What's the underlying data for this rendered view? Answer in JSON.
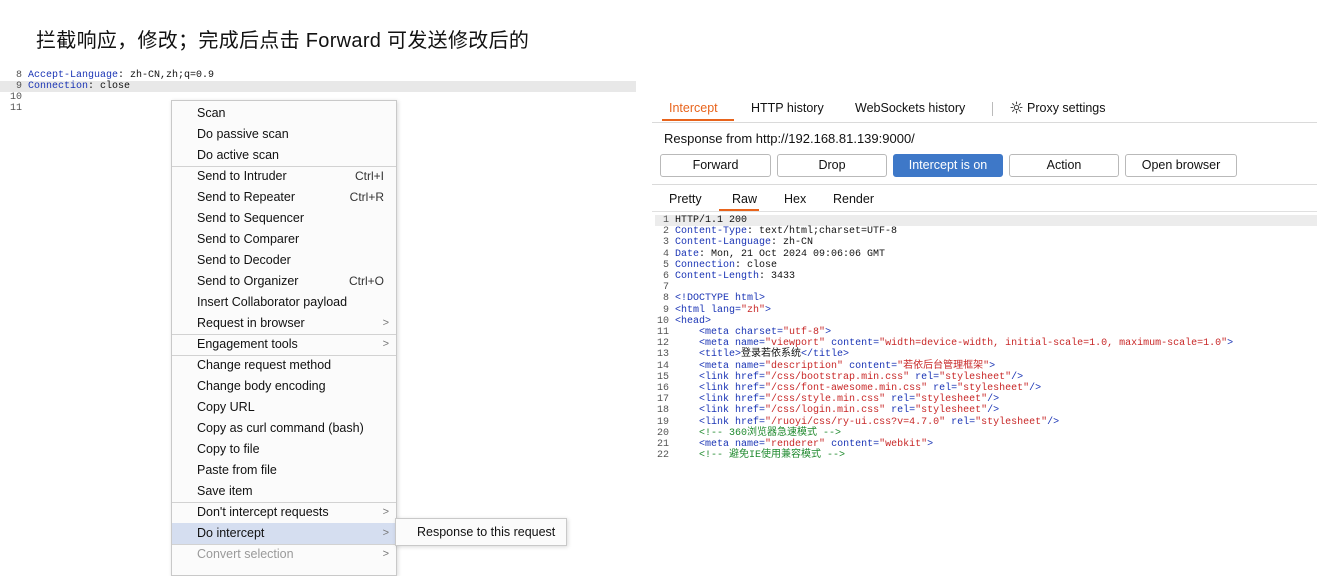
{
  "caption": "拦截响应，修改；完成后点击 Forward 可发送修改后的",
  "left_editor": {
    "lines": [
      {
        "num": "8",
        "key": "Accept-Language",
        "value": ": zh-CN,zh;q=0.9"
      },
      {
        "num": "9",
        "key": "Connection",
        "value": ": close"
      },
      {
        "num": "10",
        "key": "",
        "value": ""
      },
      {
        "num": "11",
        "key": "",
        "value": ""
      }
    ]
  },
  "context_menu": {
    "items": [
      {
        "label": "Scan"
      },
      {
        "label": "Do passive scan"
      },
      {
        "label": "Do active scan"
      },
      {
        "label": "Send to Intruder",
        "shortcut": "Ctrl+I"
      },
      {
        "label": "Send to Repeater",
        "shortcut": "Ctrl+R"
      },
      {
        "label": "Send to Sequencer"
      },
      {
        "label": "Send to Comparer"
      },
      {
        "label": "Send to Decoder"
      },
      {
        "label": "Send to Organizer",
        "shortcut": "Ctrl+O"
      },
      {
        "label": "Insert Collaborator payload"
      },
      {
        "label": "Request in browser",
        "arrow": ">"
      },
      {
        "label": "Engagement tools",
        "arrow": ">"
      },
      {
        "label": "Change request method"
      },
      {
        "label": "Change body encoding"
      },
      {
        "label": "Copy URL"
      },
      {
        "label": "Copy as curl command (bash)"
      },
      {
        "label": "Copy to file"
      },
      {
        "label": "Paste from file"
      },
      {
        "label": "Save item"
      },
      {
        "label": "Don't intercept requests",
        "arrow": ">"
      },
      {
        "label": "Do intercept",
        "arrow": ">"
      },
      {
        "label": "Convert selection",
        "arrow": ">"
      }
    ],
    "submenu_label": "Response to this request"
  },
  "tabs": {
    "intercept": "Intercept",
    "http_history": "HTTP history",
    "websockets_history": "WebSockets history",
    "proxy_settings": "Proxy settings"
  },
  "response_from": "Response from http://192.168.81.139:9000/",
  "buttons": {
    "forward": "Forward",
    "drop": "Drop",
    "intercept_on": "Intercept is on",
    "action": "Action",
    "open_browser": "Open browser"
  },
  "subtabs": {
    "pretty": "Pretty",
    "raw": "Raw",
    "hex": "Hex",
    "render": "Render"
  },
  "colors": {
    "accent": "#e8641c",
    "primary_button": "#3e78c8",
    "menu_highlight": "#d5def0"
  },
  "response_lines": [
    {
      "num": "1",
      "text": "HTTP/1.1 200"
    },
    {
      "num": "2",
      "header": "Content-Type",
      "value": ": text/html;charset=UTF-8"
    },
    {
      "num": "3",
      "header": "Content-Language",
      "value": ": zh-CN"
    },
    {
      "num": "4",
      "header": "Date",
      "value": ": Mon, 21 Oct 2024 09:06:06 GMT"
    },
    {
      "num": "5",
      "header": "Connection",
      "value": ": close"
    },
    {
      "num": "6",
      "header": "Content-Length",
      "value": ": 3433"
    },
    {
      "num": "7",
      "text": ""
    },
    {
      "num": "8",
      "html": [
        [
          "tg",
          "<!DOCTYPE html>"
        ]
      ]
    },
    {
      "num": "9",
      "html": [
        [
          "tg",
          "<html "
        ],
        [
          "at",
          "lang="
        ],
        [
          "av",
          "\"zh\""
        ],
        [
          "tg",
          ">"
        ]
      ]
    },
    {
      "num": "10",
      "html": [
        [
          "tg",
          "<head>"
        ]
      ]
    },
    {
      "num": "11",
      "html": [
        [
          "tx",
          "    "
        ],
        [
          "tg",
          "<meta "
        ],
        [
          "at",
          "charset="
        ],
        [
          "av",
          "\"utf-8\""
        ],
        [
          "tg",
          ">"
        ]
      ]
    },
    {
      "num": "12",
      "html": [
        [
          "tx",
          "    "
        ],
        [
          "tg",
          "<meta "
        ],
        [
          "at",
          "name="
        ],
        [
          "av",
          "\"viewport\""
        ],
        [
          "at",
          " content="
        ],
        [
          "av",
          "\"width=device-width, initial-scale=1.0, maximum-scale=1.0\""
        ],
        [
          "tg",
          ">"
        ]
      ]
    },
    {
      "num": "13",
      "html": [
        [
          "tx",
          "    "
        ],
        [
          "tg",
          "<title>"
        ],
        [
          "tx",
          "登录若依系统"
        ],
        [
          "tg",
          "</title>"
        ]
      ]
    },
    {
      "num": "14",
      "html": [
        [
          "tx",
          "    "
        ],
        [
          "tg",
          "<meta "
        ],
        [
          "at",
          "name="
        ],
        [
          "av",
          "\"description\""
        ],
        [
          "at",
          " content="
        ],
        [
          "av",
          "\"若依后台管理框架\""
        ],
        [
          "tg",
          ">"
        ]
      ]
    },
    {
      "num": "15",
      "html": [
        [
          "tx",
          "    "
        ],
        [
          "tg",
          "<link "
        ],
        [
          "at",
          "href="
        ],
        [
          "av",
          "\"/css/bootstrap.min.css\""
        ],
        [
          "at",
          " rel="
        ],
        [
          "av",
          "\"stylesheet\""
        ],
        [
          "tg",
          "/>"
        ]
      ]
    },
    {
      "num": "16",
      "html": [
        [
          "tx",
          "    "
        ],
        [
          "tg",
          "<link "
        ],
        [
          "at",
          "href="
        ],
        [
          "av",
          "\"/css/font-awesome.min.css\""
        ],
        [
          "at",
          " rel="
        ],
        [
          "av",
          "\"stylesheet\""
        ],
        [
          "tg",
          "/>"
        ]
      ]
    },
    {
      "num": "17",
      "html": [
        [
          "tx",
          "    "
        ],
        [
          "tg",
          "<link "
        ],
        [
          "at",
          "href="
        ],
        [
          "av",
          "\"/css/style.min.css\""
        ],
        [
          "at",
          " rel="
        ],
        [
          "av",
          "\"stylesheet\""
        ],
        [
          "tg",
          "/>"
        ]
      ]
    },
    {
      "num": "18",
      "html": [
        [
          "tx",
          "    "
        ],
        [
          "tg",
          "<link "
        ],
        [
          "at",
          "href="
        ],
        [
          "av",
          "\"/css/login.min.css\""
        ],
        [
          "at",
          " rel="
        ],
        [
          "av",
          "\"stylesheet\""
        ],
        [
          "tg",
          "/>"
        ]
      ]
    },
    {
      "num": "19",
      "html": [
        [
          "tx",
          "    "
        ],
        [
          "tg",
          "<link "
        ],
        [
          "at",
          "href="
        ],
        [
          "av",
          "\"/ruoyi/css/ry-ui.css?v=4.7.0\""
        ],
        [
          "at",
          " rel="
        ],
        [
          "av",
          "\"stylesheet\""
        ],
        [
          "tg",
          "/>"
        ]
      ]
    },
    {
      "num": "20",
      "html": [
        [
          "tx",
          "    "
        ],
        [
          "cm",
          "<!-- 360浏览器急速模式 -->"
        ]
      ]
    },
    {
      "num": "21",
      "html": [
        [
          "tx",
          "    "
        ],
        [
          "tg",
          "<meta "
        ],
        [
          "at",
          "name="
        ],
        [
          "av",
          "\"renderer\""
        ],
        [
          "at",
          " content="
        ],
        [
          "av",
          "\"webkit\""
        ],
        [
          "tg",
          ">"
        ]
      ]
    },
    {
      "num": "22",
      "html": [
        [
          "tx",
          "    "
        ],
        [
          "cm",
          "<!-- 避免IE使用兼容模式 -->"
        ]
      ]
    }
  ]
}
